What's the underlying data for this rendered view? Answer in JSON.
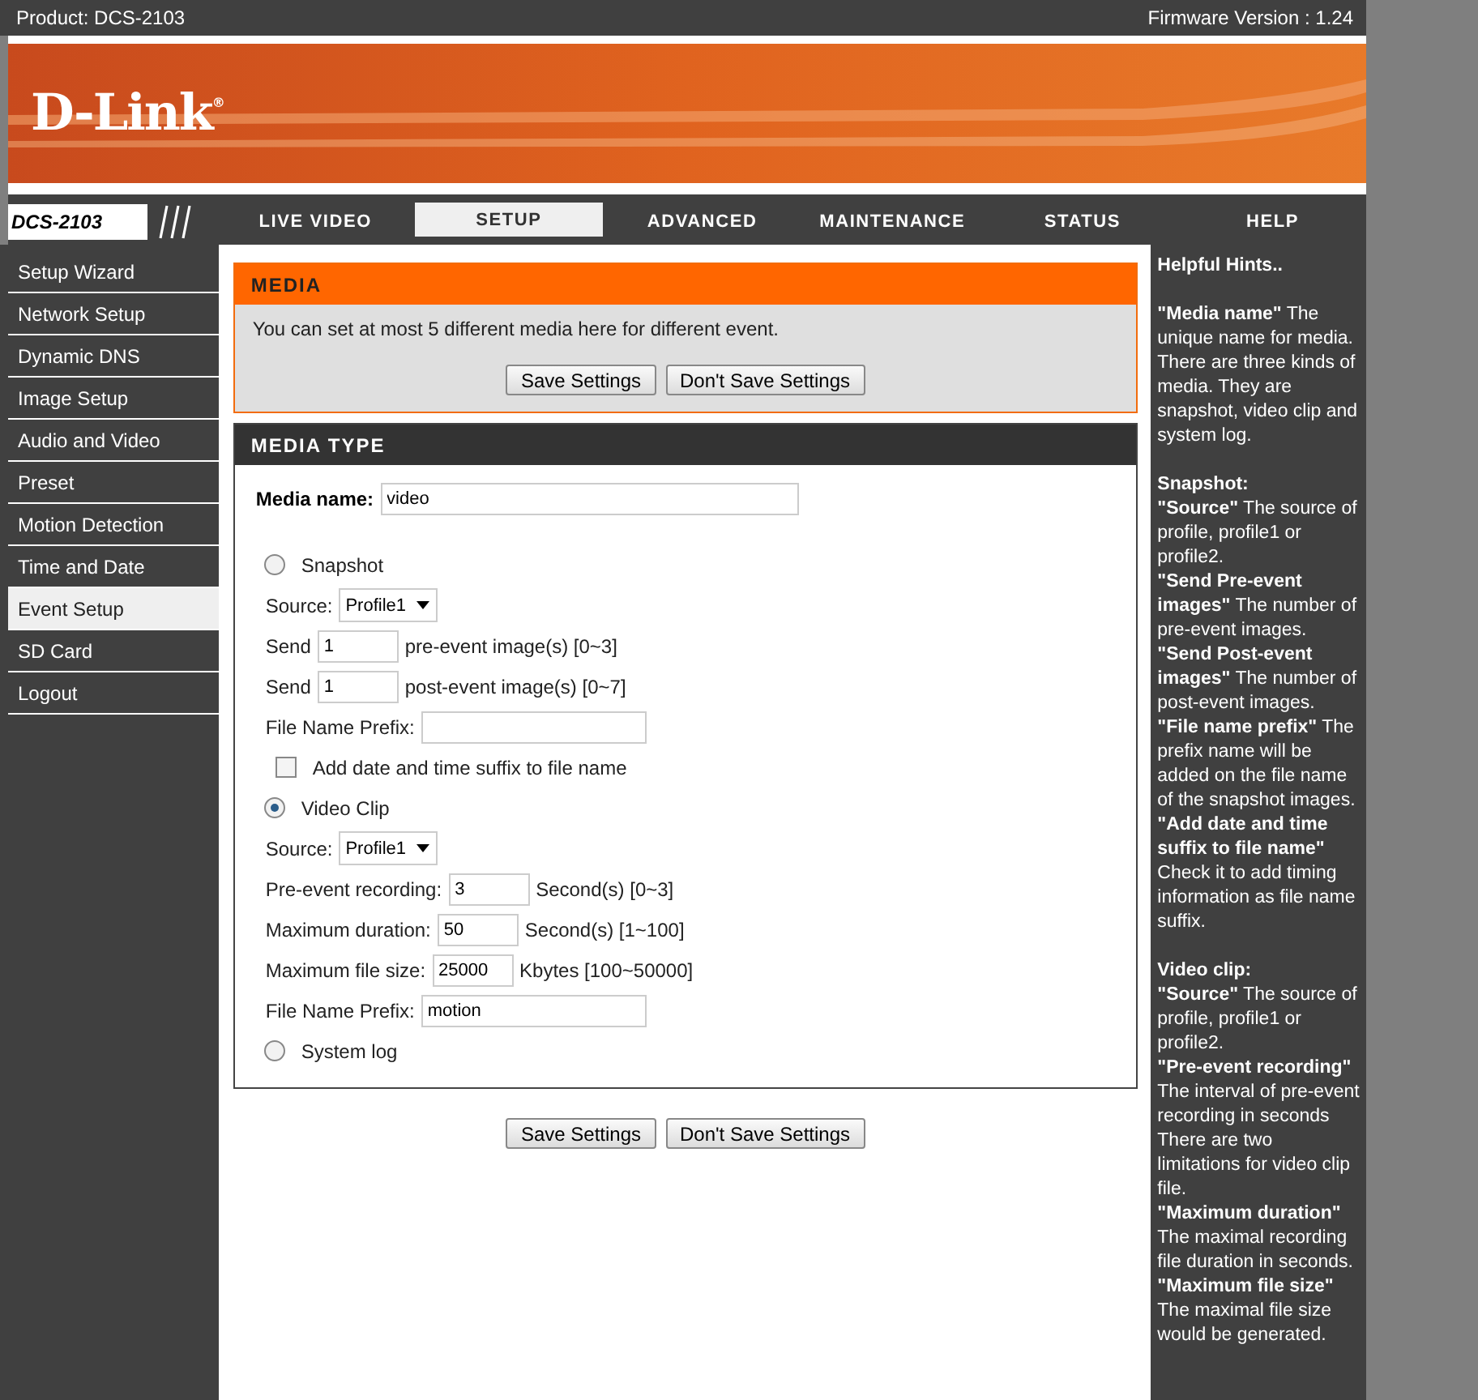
{
  "header": {
    "product": "Product: DCS-2103",
    "firmware": "Firmware Version : 1.24"
  },
  "logo": "D-Link$^{®}$",
  "model": "DCS-2103",
  "tabs": [
    {
      "label": "LIVE VIDEO",
      "selected": false
    },
    {
      "label": "SETUP",
      "selected": true
    },
    {
      "label": "ADVANCED",
      "selected": false
    },
    {
      "label": "MAINTENANCE",
      "selected": false
    },
    {
      "label": "STATUS",
      "selected": false
    },
    {
      "label": "HELP",
      "selected": false
    }
  ],
  "sidebar": [
    {
      "label": "Setup Wizard",
      "selected": false
    },
    {
      "label": "Network Setup",
      "selected": false
    },
    {
      "label": "Dynamic DNS",
      "selected": false
    },
    {
      "label": "Image Setup",
      "selected": false
    },
    {
      "label": "Audio and Video",
      "selected": false
    },
    {
      "label": "Preset",
      "selected": false
    },
    {
      "label": "Motion Detection",
      "selected": false
    },
    {
      "label": "Time and Date",
      "selected": false
    },
    {
      "label": "Event Setup",
      "selected": true
    },
    {
      "label": "SD Card",
      "selected": false
    },
    {
      "label": "Logout",
      "selected": false
    }
  ],
  "media": {
    "title": "MEDIA",
    "text": "You can set at most 5 different media here for different event.",
    "buttons": [
      "Save Settings",
      "Don't Save Settings"
    ]
  },
  "media_type": {
    "title": "MEDIA TYPE",
    "name_label": "Media name:",
    "name_value": "video",
    "options": [
      {
        "label": "Snapshot",
        "selected": false,
        "rows": [
          {
            "kind": "select",
            "label": "Source:",
            "value": "Profile1"
          },
          {
            "kind": "input",
            "label": "Send",
            "value": "1",
            "suffix": "pre-event image(s) [0~3]"
          },
          {
            "kind": "input",
            "label": "Send",
            "value": "1",
            "suffix": "post-event image(s) [0~7]"
          },
          {
            "kind": "input",
            "label": "File Name Prefix:"
          },
          {
            "kind": "checkbox",
            "label": "Add date and time suffix to file name",
            "checked": false
          }
        ]
      },
      {
        "label": "Video Clip",
        "selected": true,
        "rows": [
          {
            "kind": "select",
            "label": "Source:",
            "value": "Profile1"
          },
          {
            "kind": "input",
            "label": "Pre-event recording:",
            "value": "3",
            "suffix": "Second(s) [0~3]"
          },
          {
            "kind": "input",
            "label": "Maximum duration:",
            "value": "50",
            "suffix": "Second(s) [1~100]"
          },
          {
            "kind": "input",
            "label": "Maximum file size:",
            "value": "25000",
            "suffix": "Kbytes [100~50000]"
          },
          {
            "kind": "input",
            "label": "File Name Prefix:",
            "value": "motion"
          }
        ]
      },
      {
        "label": "System log",
        "selected": false
      }
    ]
  },
  "bottom_buttons": [
    "Save Settings",
    "Don't Save Settings"
  ],
  "hints": {
    "title": "Helpful Hints..",
    "groups": [
      {
        "entries": [
          "**\"Media name\"** The unique name for media. There are three kinds of media. They are snapshot, video clip and system log."
        ]
      },
      {
        "heading": "Snapshot:",
        "entries": [
          "**\"Source\"** The source of profile, profile1 or profile2.",
          "**\"Send Pre-event images\"** The number of pre-event images.",
          "**\"Send Post-event images\"** The number of post-event images.",
          "**\"File name prefix\"** The prefix name will be added on the file name of the snapshot images.",
          "**\"Add date and time suffix to file name\"** Check it to add timing information as file name suffix."
        ]
      },
      {
        "heading": "Video clip:",
        "entries": [
          "**\"Source\"** The source of profile, profile1 or profile2.",
          "**\"Pre-event recording\"** The interval of pre-event recording in seconds There are two limitations for video clip file.",
          "**\"Maximum duration\"** The maximal recording file duration in seconds.",
          "**\"Maximum file size\"** The maximal file size would be generated."
        ]
      }
    ]
  }
}
